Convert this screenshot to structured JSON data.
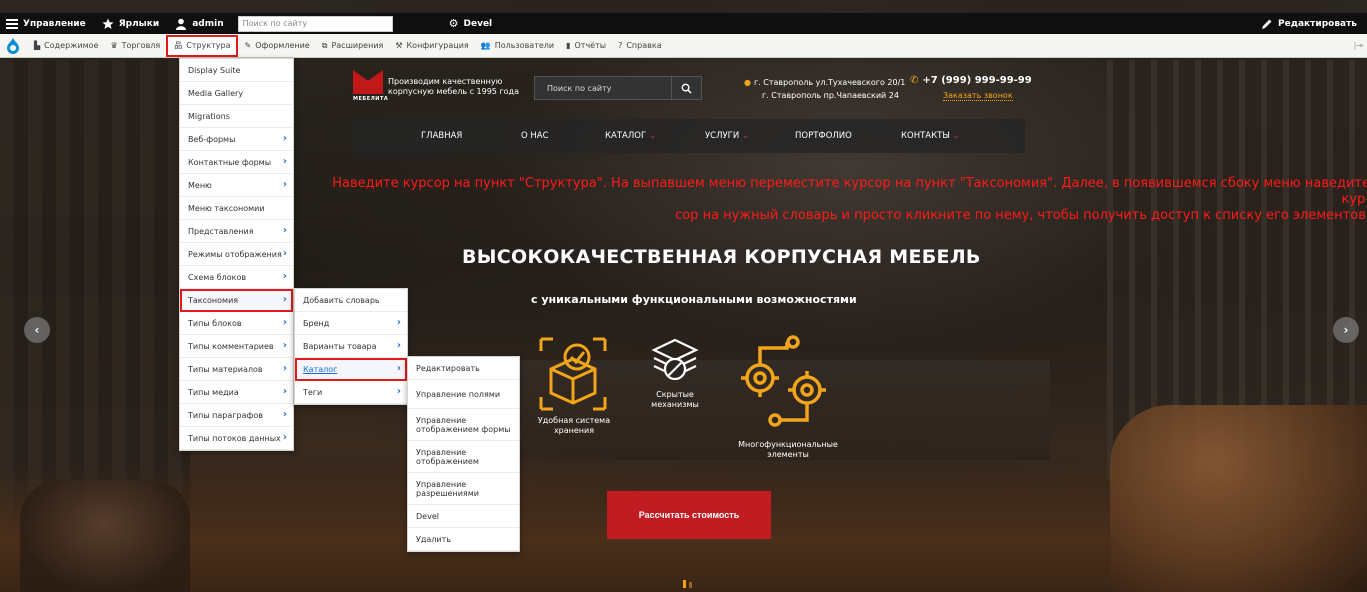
{
  "toolbar": {
    "manage": "Управление",
    "shortcuts": "Ярлыки",
    "user": "admin",
    "search_placeholder": "Поиск по сайту",
    "devel": "Devel",
    "edit": "Редактировать"
  },
  "tray": {
    "items": [
      "Содержимое",
      "Торговля",
      "Структура",
      "Оформление",
      "Расширения",
      "Конфигурация",
      "Пользователи",
      "Отчёты",
      "Справка"
    ],
    "active": "Структура"
  },
  "structure_menu": [
    {
      "label": "Display Suite",
      "has_sub": false
    },
    {
      "label": "Media Gallery",
      "has_sub": false
    },
    {
      "label": "Migrations",
      "has_sub": false
    },
    {
      "label": "Веб-формы",
      "has_sub": true
    },
    {
      "label": "Контактные формы",
      "has_sub": true
    },
    {
      "label": "Меню",
      "has_sub": true
    },
    {
      "label": "Меню таксономии",
      "has_sub": false
    },
    {
      "label": "Представления",
      "has_sub": true
    },
    {
      "label": "Режимы отображения",
      "has_sub": true
    },
    {
      "label": "Схема блоков",
      "has_sub": true
    },
    {
      "label": "Таксономия",
      "has_sub": true
    },
    {
      "label": "Типы блоков",
      "has_sub": true
    },
    {
      "label": "Типы комментариев",
      "has_sub": true
    },
    {
      "label": "Типы материалов",
      "has_sub": true
    },
    {
      "label": "Типы медиа",
      "has_sub": true
    },
    {
      "label": "Типы параграфов",
      "has_sub": true
    },
    {
      "label": "Типы потоков данных",
      "has_sub": true
    }
  ],
  "taxonomy_menu": [
    {
      "label": "Добавить словарь",
      "has_sub": false
    },
    {
      "label": "Бренд",
      "has_sub": true
    },
    {
      "label": "Варианты товара",
      "has_sub": true
    },
    {
      "label": "Каталог",
      "has_sub": true
    },
    {
      "label": "Теги",
      "has_sub": true
    }
  ],
  "catalog_menu": [
    "Редактировать",
    "Управление полями",
    "Управление отображением формы",
    "Управление отображением",
    "Управление разрешениями",
    "Devel",
    "Удалить"
  ],
  "site": {
    "logo_text": "МЕБЕЛИТА",
    "tagline": "Производим качественную корпусную мебель с 1995 года",
    "search_placeholder": "Поиск по сайту",
    "address_1": "г. Ставрополь ул.Тухачевского 20/1",
    "address_2": "г. Ставрополь пр.Чапаевский 24",
    "phone": "+7 (999) 999-99-99",
    "callback": "Заказать звонок",
    "nav": [
      "ГЛАВНАЯ",
      "О НАС",
      "КАТАЛОГ",
      "УСЛУГИ",
      "ПОРТФОЛИО",
      "КОНТАКТЫ"
    ],
    "instruction_line1": "Наведите курсор на пункт \"Структура\".  На выпавшем меню переместите курсор на пункт \"Таксономия\". Далее, в появившемся сбоку меню наведите кур-",
    "instruction_line2": "сор на нужный словарь и просто кликните по нему, чтобы получить доступ к списку его элементов.",
    "hero_title": "ВЫСОКОКАЧЕСТВЕННАЯ КОРПУСНАЯ МЕБЕЛЬ",
    "hero_subtitle": "с уникальными функциональными возможностями",
    "feature_1": "Удобная система хранения",
    "feature_2": "Скрытые механизмы",
    "feature_3": "Многофункциональные элементы",
    "cta": "Рассчитать стоимость"
  },
  "colors": {
    "accent_red": "#c21c23",
    "highlight_outline": "#e01b1b",
    "gold": "#f2a51a",
    "link_blue": "#1e6bd6"
  }
}
